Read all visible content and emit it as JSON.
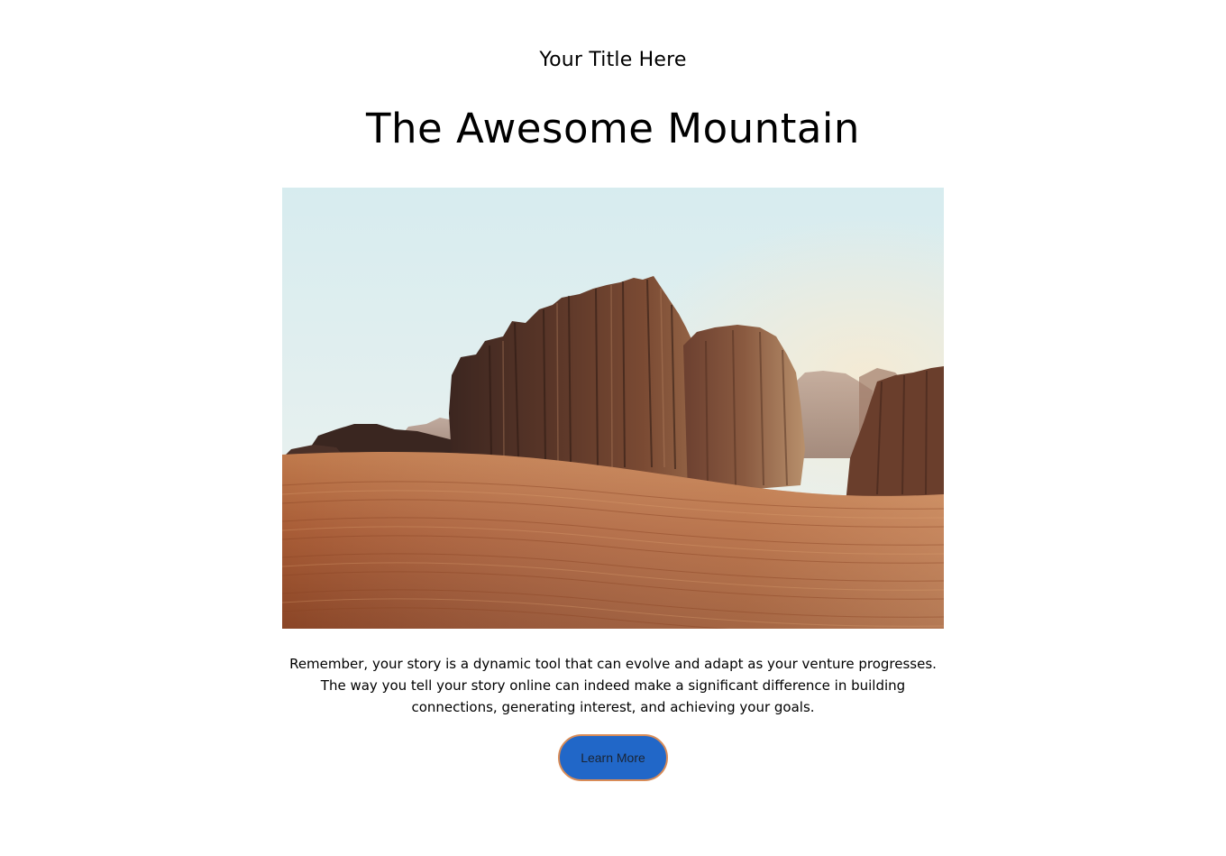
{
  "header": {
    "site_title": "Your Title Here"
  },
  "main": {
    "title": "The Awesome Mountain",
    "image": {
      "subject": "desert-rock-formations-and-sand-dune"
    },
    "body": "Remember, your story is a dynamic tool that can evolve and adapt as your venture progresses. The way you tell your story online can indeed make a significant difference in building connections, generating interest, and achieving your goals.",
    "cta_label": "Learn More"
  },
  "colors": {
    "background": "#ffffff",
    "text": "#000000",
    "button_fill": "#2167c8",
    "button_border": "#d98c57",
    "button_text": "#1a2433"
  }
}
